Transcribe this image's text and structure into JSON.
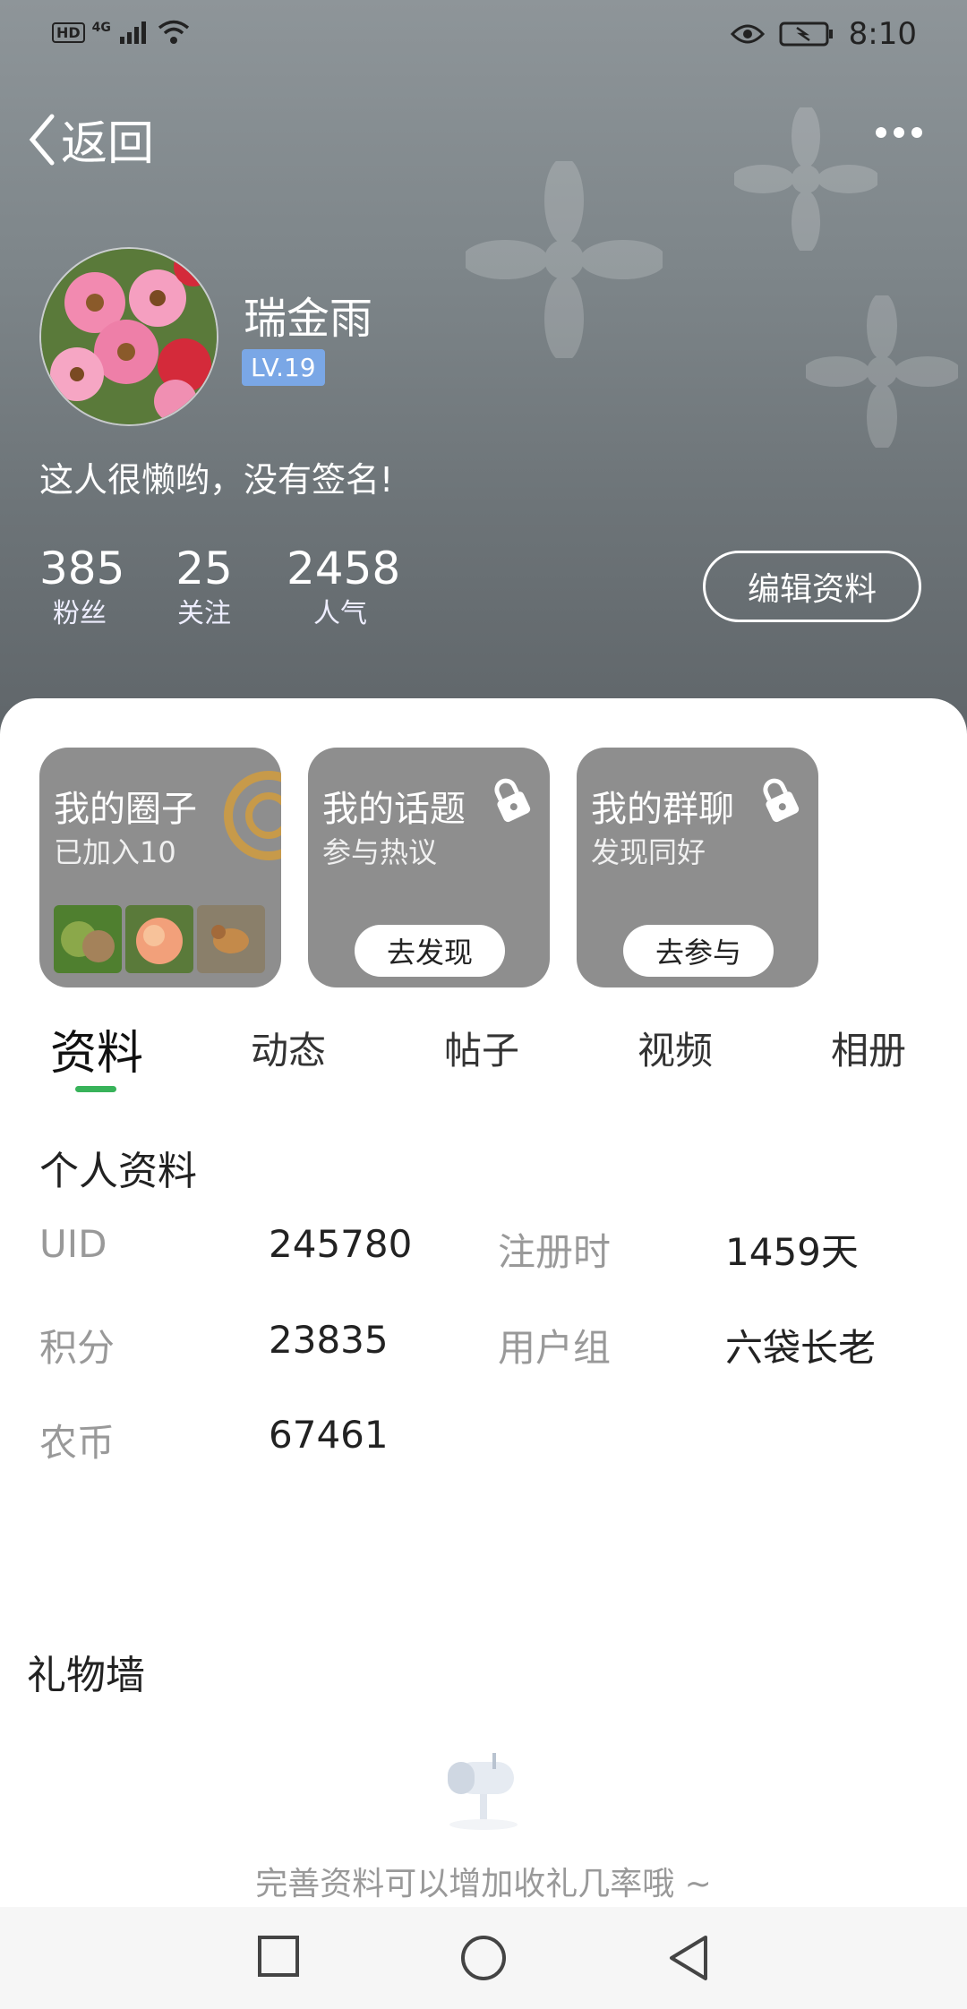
{
  "status_bar": {
    "time": "8:10",
    "network": "4G",
    "hd": "HD"
  },
  "nav": {
    "back_label": "返回"
  },
  "profile": {
    "name": "瑞金雨",
    "level": "LV.19",
    "signature": "这人很懒哟，没有签名!",
    "stats": [
      {
        "value": "385",
        "label": "粉丝"
      },
      {
        "value": "25",
        "label": "关注"
      },
      {
        "value": "2458",
        "label": "人气"
      }
    ],
    "edit_button": "编辑资料"
  },
  "cards": [
    {
      "title": "我的圈子",
      "subtitle": "已加入10"
    },
    {
      "title": "我的话题",
      "subtitle": "参与热议",
      "button": "去发现"
    },
    {
      "title": "我的群聊",
      "subtitle": "发现同好",
      "button": "去参与"
    }
  ],
  "tabs": [
    "资料",
    "动态",
    "帖子",
    "视频",
    "相册"
  ],
  "personal_info": {
    "title": "个人资料",
    "rows": [
      {
        "label1": "UID",
        "value1": "245780",
        "label2": "注册时",
        "value2": "1459天"
      },
      {
        "label1": "积分",
        "value1": "23835",
        "label2": "用户组",
        "value2": "六袋长老"
      },
      {
        "label1": "农币",
        "value1": "67461"
      }
    ]
  },
  "gift_wall": {
    "title": "礼物墙",
    "empty_text": "完善资料可以增加收礼几率哦 ~"
  },
  "colors": {
    "accent": "#38b35a",
    "level_badge": "#7aa7e6",
    "card_bg": "#8e8e8e"
  }
}
